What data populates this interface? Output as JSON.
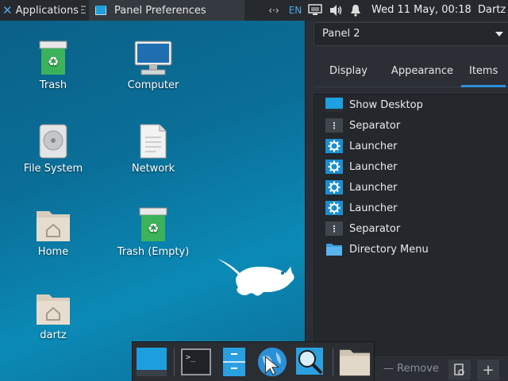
{
  "top_panel": {
    "applications_label": "Applications",
    "applications_sep": "☲",
    "task_title": "Panel Preferences",
    "language": "EN",
    "clock": "Wed 11 May, 00:18",
    "user": "Dartz",
    "network_glyph": "‹·›"
  },
  "desktop": {
    "icons": [
      {
        "label": "Trash",
        "icon": "trash-full-icon"
      },
      {
        "label": "Computer",
        "icon": "computer-icon"
      },
      {
        "label": "File System",
        "icon": "harddisk-icon"
      },
      {
        "label": "Network",
        "icon": "network-icon"
      },
      {
        "label": "Home",
        "icon": "home-folder-icon"
      },
      {
        "label": "Trash (Empty)",
        "icon": "trash-empty-icon"
      },
      {
        "label": "dartz",
        "icon": "user-folder-icon"
      }
    ]
  },
  "prefs": {
    "panel_select_value": "Panel 2",
    "tabs": [
      {
        "label": "Display"
      },
      {
        "label": "Appearance"
      },
      {
        "label": "Items"
      }
    ],
    "active_tab": "Items",
    "items": [
      {
        "label": "Show Desktop",
        "icon": "show-desktop-icon"
      },
      {
        "label": "Separator",
        "icon": "separator-icon"
      },
      {
        "label": "Launcher",
        "icon": "launcher-icon"
      },
      {
        "label": "Launcher",
        "icon": "launcher-icon"
      },
      {
        "label": "Launcher",
        "icon": "launcher-icon"
      },
      {
        "label": "Launcher",
        "icon": "launcher-icon"
      },
      {
        "label": "Separator",
        "icon": "separator-icon"
      },
      {
        "label": "Directory Menu",
        "icon": "folder-icon"
      }
    ],
    "remove_label": "Remove"
  },
  "dock": {
    "items": [
      "show-desktop-icon",
      "terminal-icon",
      "file-manager-icon",
      "browser-icon",
      "search-icon",
      "home-folder-icon"
    ]
  },
  "colors": {
    "accent": "#2d8fd9",
    "panel_bg": "#262a2f",
    "window_bg": "#2b2f35"
  }
}
